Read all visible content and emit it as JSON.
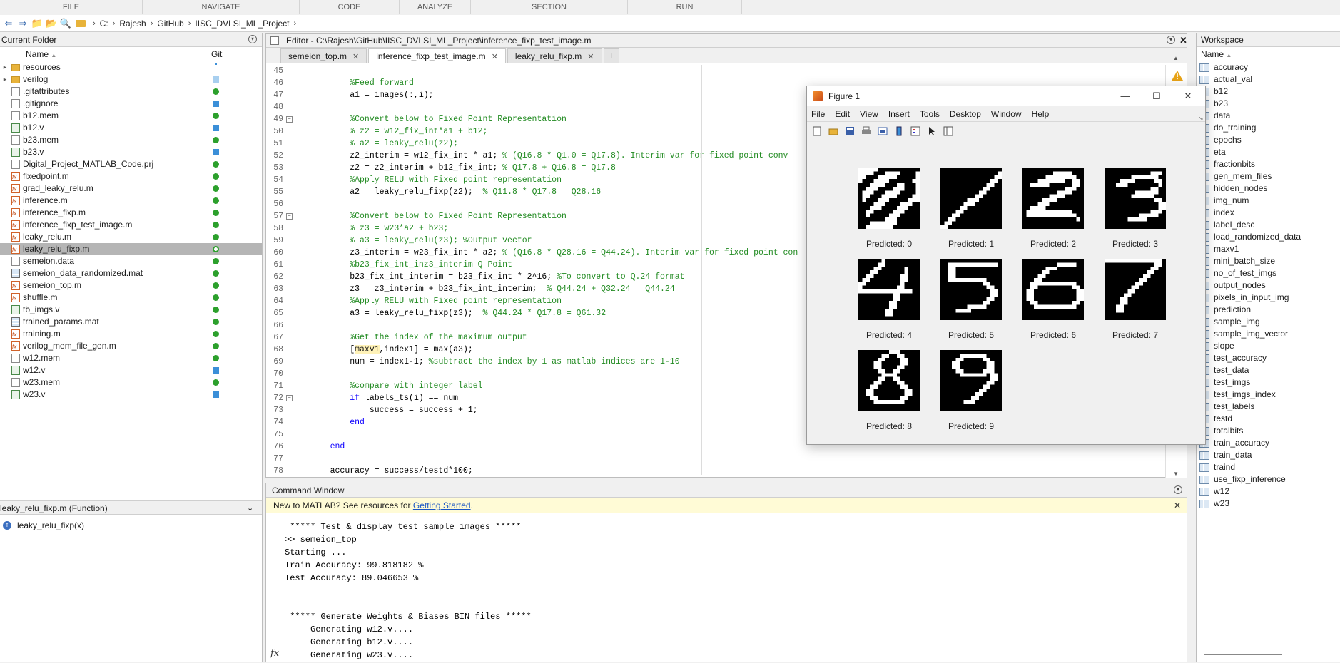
{
  "ribbon": {
    "tabs": [
      "FILE",
      "NAVIGATE",
      "CODE",
      "ANALYZE",
      "SECTION",
      "RUN"
    ]
  },
  "address": {
    "crumbs": [
      "C:",
      "Rajesh",
      "GitHub",
      "IISC_DVLSI_ML_Project"
    ]
  },
  "current_folder": {
    "title": "Current Folder",
    "col_name": "Name",
    "col_git": "Git",
    "items": [
      {
        "name": "resources",
        "type": "folder",
        "git": "dot"
      },
      {
        "name": "verilog",
        "type": "folder",
        "git": "lightblue"
      },
      {
        "name": ".gitattributes",
        "type": "file",
        "git": "green"
      },
      {
        "name": ".gitignore",
        "type": "file",
        "git": "blue"
      },
      {
        "name": "b12.mem",
        "type": "file",
        "git": "green"
      },
      {
        "name": "b12.v",
        "type": "vfile",
        "git": "blue"
      },
      {
        "name": "b23.mem",
        "type": "file",
        "git": "green"
      },
      {
        "name": "b23.v",
        "type": "vfile",
        "git": "blue"
      },
      {
        "name": "Digital_Project_MATLAB_Code.prj",
        "type": "file",
        "git": "green"
      },
      {
        "name": "fixedpoint.m",
        "type": "mfile",
        "git": "green"
      },
      {
        "name": "grad_leaky_relu.m",
        "type": "mfile",
        "git": "green"
      },
      {
        "name": "inference.m",
        "type": "mfile",
        "git": "green"
      },
      {
        "name": "inference_fixp.m",
        "type": "mfile",
        "git": "green"
      },
      {
        "name": "inference_fixp_test_image.m",
        "type": "mfile",
        "git": "green"
      },
      {
        "name": "leaky_relu.m",
        "type": "mfile",
        "git": "green"
      },
      {
        "name": "leaky_relu_fixp.m",
        "type": "mfile",
        "git": "green-ring",
        "selected": true
      },
      {
        "name": "semeion.data",
        "type": "file",
        "git": "green"
      },
      {
        "name": "semeion_data_randomized.mat",
        "type": "mat",
        "git": "green"
      },
      {
        "name": "semeion_top.m",
        "type": "mfile",
        "git": "green"
      },
      {
        "name": "shuffle.m",
        "type": "mfile",
        "git": "green"
      },
      {
        "name": "tb_imgs.v",
        "type": "vfile",
        "git": "green"
      },
      {
        "name": "trained_params.mat",
        "type": "mat",
        "git": "green"
      },
      {
        "name": "training.m",
        "type": "mfile",
        "git": "green"
      },
      {
        "name": "verilog_mem_file_gen.m",
        "type": "mfile",
        "git": "green"
      },
      {
        "name": "w12.mem",
        "type": "file",
        "git": "green"
      },
      {
        "name": "w12.v",
        "type": "vfile",
        "git": "blue"
      },
      {
        "name": "w23.mem",
        "type": "file",
        "git": "green"
      },
      {
        "name": "w23.v",
        "type": "vfile",
        "git": "blue"
      }
    ],
    "details_title": "leaky_relu_fixp.m  (Function)",
    "details_function": "leaky_relu_fixp(x)"
  },
  "editor": {
    "title": "Editor - C:\\Rajesh\\GitHub\\IISC_DVLSI_ML_Project\\inference_fixp_test_image.m",
    "tabs": [
      {
        "label": "semeion_top.m",
        "active": false
      },
      {
        "label": "inference_fixp_test_image.m",
        "active": true
      },
      {
        "label": "leaky_relu_fixp.m",
        "active": false
      }
    ],
    "lines": [
      {
        "n": "45",
        "indent": "",
        "parts": []
      },
      {
        "n": "46",
        "indent": "        ",
        "parts": [
          {
            "t": "%Feed forward",
            "c": "comment"
          }
        ]
      },
      {
        "n": "47",
        "indent": "        ",
        "parts": [
          {
            "t": "a1 = images(:,i);",
            "c": "plain"
          }
        ]
      },
      {
        "n": "48",
        "indent": "",
        "parts": []
      },
      {
        "n": "49",
        "indent": "        ",
        "fold": true,
        "parts": [
          {
            "t": "%Convert below to Fixed Point Representation",
            "c": "comment"
          }
        ]
      },
      {
        "n": "50",
        "indent": "        ",
        "parts": [
          {
            "t": "% z2 = w12_fix_int*a1 + b12;",
            "c": "comment"
          }
        ]
      },
      {
        "n": "51",
        "indent": "        ",
        "parts": [
          {
            "t": "% a2 = leaky_relu(z2);",
            "c": "comment"
          }
        ]
      },
      {
        "n": "52",
        "indent": "        ",
        "parts": [
          {
            "t": "z2_interim = w12_fix_int * a1; ",
            "c": "plain"
          },
          {
            "t": "% (Q16.8 * Q1.0 = Q17.8). Interim var for fixed point conv",
            "c": "comment"
          }
        ]
      },
      {
        "n": "53",
        "indent": "        ",
        "parts": [
          {
            "t": "z2 = z2_interim + b12_fix_int; ",
            "c": "plain"
          },
          {
            "t": "% Q17.8 + Q16.8 = Q17.8",
            "c": "comment"
          }
        ]
      },
      {
        "n": "54",
        "indent": "        ",
        "parts": [
          {
            "t": "%Apply RELU with Fixed point representation",
            "c": "comment"
          }
        ]
      },
      {
        "n": "55",
        "indent": "        ",
        "parts": [
          {
            "t": "a2 = leaky_relu_fixp(z2);  ",
            "c": "plain"
          },
          {
            "t": "% Q11.8 * Q17.8 = Q28.16",
            "c": "comment"
          }
        ]
      },
      {
        "n": "56",
        "indent": "",
        "parts": []
      },
      {
        "n": "57",
        "indent": "        ",
        "fold": true,
        "parts": [
          {
            "t": "%Convert below to Fixed Point Representation",
            "c": "comment"
          }
        ]
      },
      {
        "n": "58",
        "indent": "        ",
        "parts": [
          {
            "t": "% z3 = w23*a2 + b23;",
            "c": "comment"
          }
        ]
      },
      {
        "n": "59",
        "indent": "        ",
        "parts": [
          {
            "t": "% a3 = leaky_relu(z3); %Output vector",
            "c": "comment"
          }
        ]
      },
      {
        "n": "60",
        "indent": "        ",
        "parts": [
          {
            "t": "z3_interim = w23_fix_int * a2; ",
            "c": "plain"
          },
          {
            "t": "% (Q16.8 * Q28.16 = Q44.24). Interim var for fixed point con",
            "c": "comment"
          }
        ]
      },
      {
        "n": "61",
        "indent": "        ",
        "parts": [
          {
            "t": "%b23_fix_int_inz3_interim Q Point",
            "c": "comment"
          }
        ]
      },
      {
        "n": "62",
        "indent": "        ",
        "parts": [
          {
            "t": "b23_fix_int_interim = b23_fix_int * 2^16; ",
            "c": "plain"
          },
          {
            "t": "%To convert to Q.24 format",
            "c": "comment"
          }
        ]
      },
      {
        "n": "63",
        "indent": "        ",
        "parts": [
          {
            "t": "z3 = z3_interim + b23_fix_int_interim;  ",
            "c": "plain"
          },
          {
            "t": "% Q44.24 + Q32.24 = Q44.24",
            "c": "comment"
          }
        ]
      },
      {
        "n": "64",
        "indent": "        ",
        "parts": [
          {
            "t": "%Apply RELU with Fixed point representation",
            "c": "comment"
          }
        ]
      },
      {
        "n": "65",
        "indent": "        ",
        "parts": [
          {
            "t": "a3 = leaky_relu_fixp(z3);  ",
            "c": "plain"
          },
          {
            "t": "% Q44.24 * Q17.8 = Q61.32",
            "c": "comment"
          }
        ]
      },
      {
        "n": "66",
        "indent": "",
        "parts": []
      },
      {
        "n": "67",
        "indent": "        ",
        "parts": [
          {
            "t": "%Get the index of the maximum output",
            "c": "comment"
          }
        ]
      },
      {
        "n": "68",
        "indent": "        ",
        "parts": [
          {
            "t": "[",
            "c": "plain"
          },
          {
            "t": "maxv1",
            "c": "hl"
          },
          {
            "t": ",index1] = max(a3);",
            "c": "plain"
          }
        ]
      },
      {
        "n": "69",
        "indent": "        ",
        "parts": [
          {
            "t": "num = index1-1; ",
            "c": "plain"
          },
          {
            "t": "%subtract the index by 1 as matlab indices are 1-10",
            "c": "comment"
          }
        ]
      },
      {
        "n": "70",
        "indent": "",
        "parts": []
      },
      {
        "n": "71",
        "indent": "        ",
        "parts": [
          {
            "t": "%compare with integer label",
            "c": "comment"
          }
        ]
      },
      {
        "n": "72",
        "indent": "        ",
        "fold": true,
        "parts": [
          {
            "t": "if",
            "c": "kw"
          },
          {
            "t": " labels_ts(i) == num",
            "c": "plain"
          }
        ]
      },
      {
        "n": "73",
        "indent": "            ",
        "parts": [
          {
            "t": "success = success + 1;",
            "c": "plain"
          }
        ]
      },
      {
        "n": "74",
        "indent": "        ",
        "parts": [
          {
            "t": "end",
            "c": "kw"
          }
        ]
      },
      {
        "n": "75",
        "indent": "",
        "parts": []
      },
      {
        "n": "76",
        "indent": "    ",
        "parts": [
          {
            "t": "end",
            "c": "kw"
          }
        ]
      },
      {
        "n": "77",
        "indent": "",
        "parts": []
      },
      {
        "n": "78",
        "indent": "    ",
        "parts": [
          {
            "t": "accuracy = success/testd*100;",
            "c": "plain"
          }
        ]
      }
    ]
  },
  "figure": {
    "title": "Figure 1",
    "menu": [
      "File",
      "Edit",
      "View",
      "Insert",
      "Tools",
      "Desktop",
      "Window",
      "Help"
    ],
    "digits": [
      {
        "label": "Predicted: 0"
      },
      {
        "label": "Predicted: 1"
      },
      {
        "label": "Predicted: 2"
      },
      {
        "label": "Predicted: 3"
      },
      {
        "label": "Predicted: 4"
      },
      {
        "label": "Predicted: 5"
      },
      {
        "label": "Predicted: 6"
      },
      {
        "label": "Predicted: 7"
      },
      {
        "label": "Predicted: 8"
      },
      {
        "label": "Predicted: 9"
      }
    ]
  },
  "command_window": {
    "title": "Command Window",
    "banner_prefix": "New to MATLAB? See resources for ",
    "banner_link": "Getting Started",
    "banner_suffix": ".",
    "lines": [
      " ***** Test & display test sample images *****",
      ">> semeion_top",
      "Starting ...",
      "Train Accuracy: 99.818182 %",
      "Test Accuracy: 89.046653 %",
      "",
      "",
      " ***** Generate Weights & Biases BIN files *****",
      "     Generating w12.v....",
      "     Generating b12.v....",
      "     Generating w23.v...."
    ],
    "prompt_symbol": "fx"
  },
  "workspace": {
    "title": "Workspace",
    "col_name": "Name",
    "items": [
      "accuracy",
      "actual_val",
      "b12",
      "b23",
      "data",
      "do_training",
      "epochs",
      "eta",
      "fractionbits",
      "gen_mem_files",
      "hidden_nodes",
      "img_num",
      "index",
      "label_desc",
      "load_randomized_data",
      "maxv1",
      "mini_batch_size",
      "no_of_test_imgs",
      "output_nodes",
      "pixels_in_input_img",
      "prediction",
      "sample_img",
      "sample_img_vector",
      "slope",
      "test_accuracy",
      "test_data",
      "test_imgs",
      "test_imgs_index",
      "test_labels",
      "testd",
      "totalbits",
      "train_accuracy",
      "train_data",
      "traind",
      "use_fixp_inference",
      "w12",
      "w23"
    ]
  }
}
